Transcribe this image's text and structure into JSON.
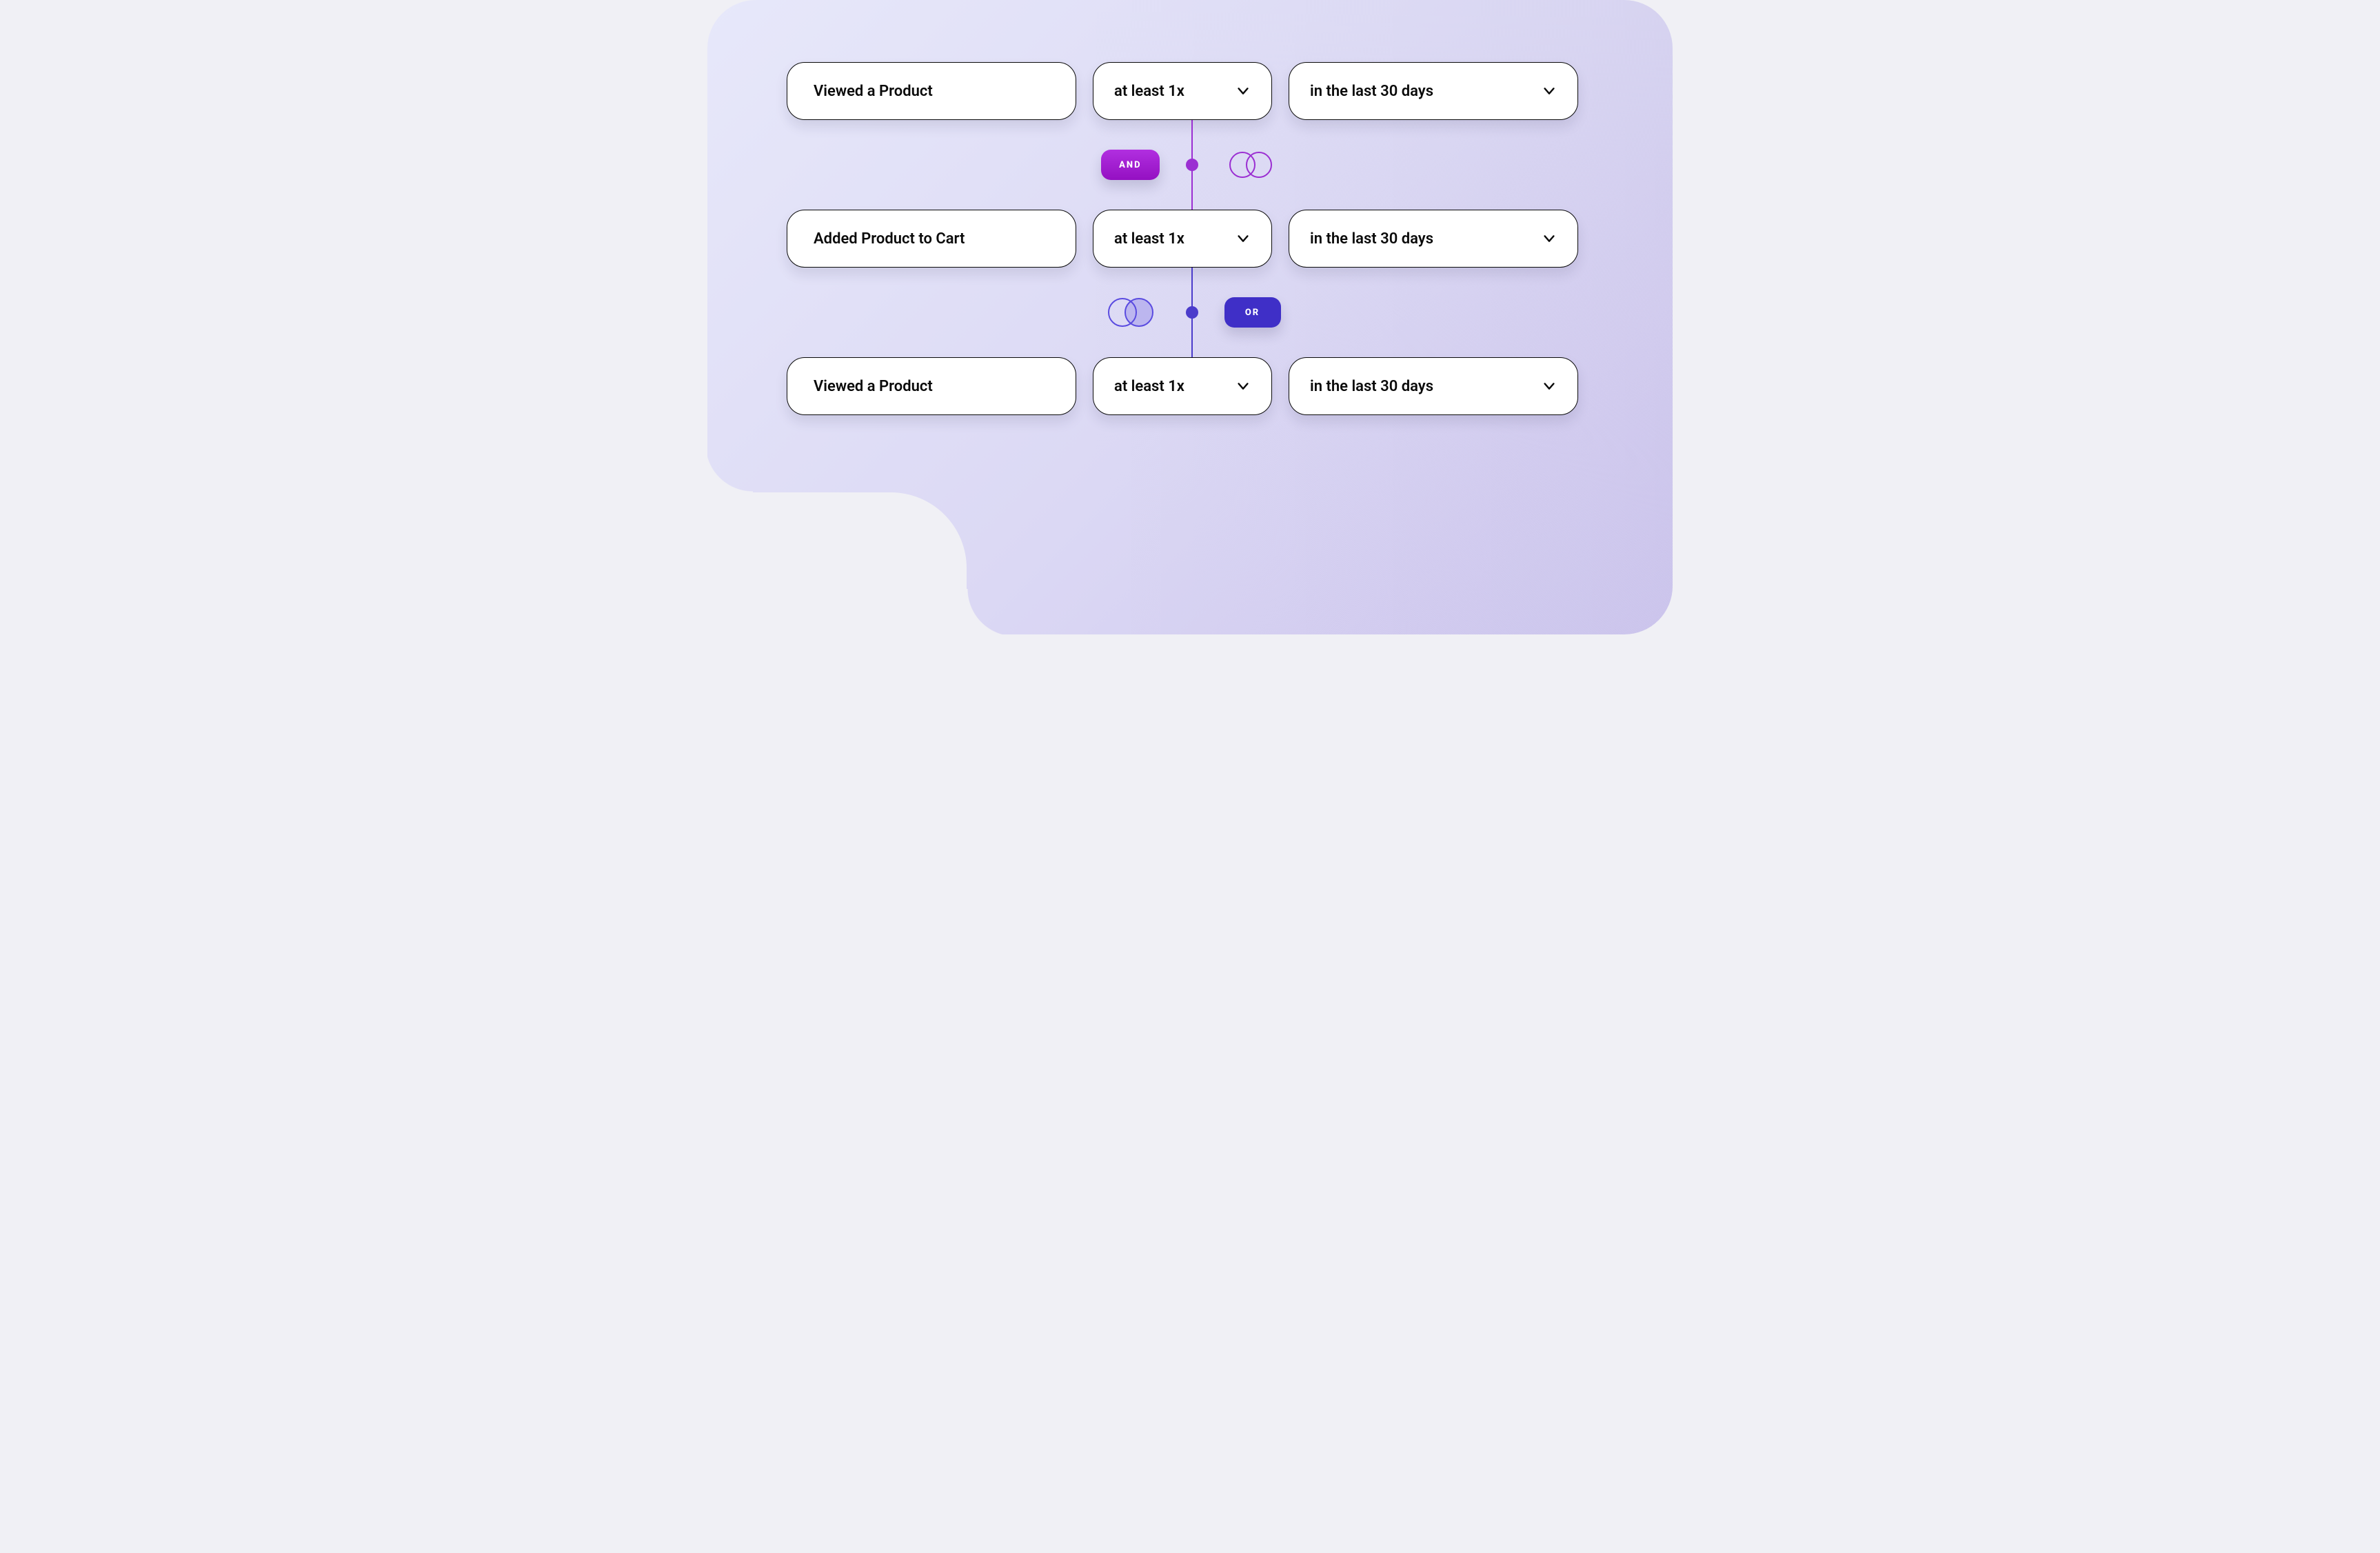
{
  "colors": {
    "and": "#9B2FD2",
    "or": "#3F2FC7",
    "or_line": "#4B3CCB",
    "pill_border": "#0a0a0a",
    "pill_bg": "#ffffff",
    "bg_from": "#E7E8FA",
    "bg_to": "#CEC7EF"
  },
  "rules": [
    {
      "event": "Viewed a Product",
      "frequency": "at least 1x",
      "range": "in the last 30 days"
    },
    {
      "event": "Added Product to Cart",
      "frequency": "at least 1x",
      "range": "in the last 30 days"
    },
    {
      "event": "Viewed a Product",
      "frequency": "at least 1x",
      "range": "in the last 30 days"
    }
  ],
  "connectors": [
    {
      "type": "AND",
      "label": "AND"
    },
    {
      "type": "OR",
      "label": "OR"
    }
  ]
}
